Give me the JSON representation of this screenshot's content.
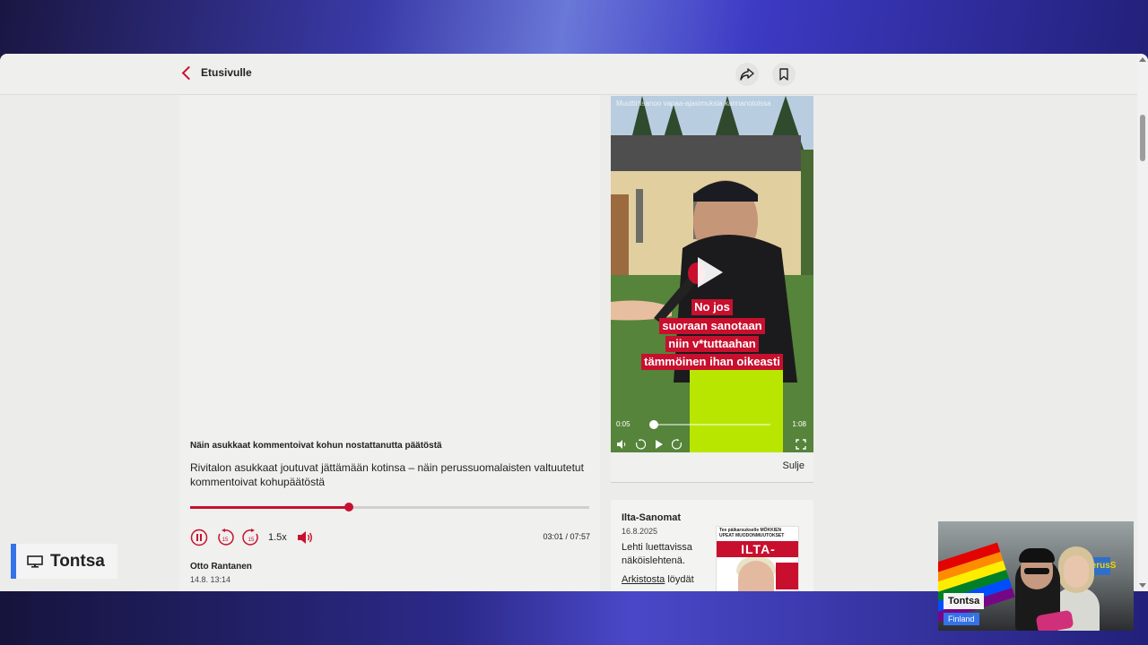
{
  "topbar": {
    "back_label": "Etusivulle"
  },
  "audio": {
    "kicker": "Näin asukkaat kommentoivat kohun nostattanutta päätöstä",
    "title": "Rivitalon asukkaat joutuvat jättämään kotinsa – näin perussuomalaisten valtuutetut kommentoivat kohupäätöstä",
    "progress_fraction": 0.397,
    "rewind_label": "15",
    "forward_label": "15",
    "speed": "1.5x",
    "time": "03:01 / 07:57",
    "author": "Otto Rantanen",
    "date": "14.8. 13:14"
  },
  "video": {
    "top_caption": "Muuttirtisanoo vapaa-ajasimuksia kannanotoissa",
    "subtitles": [
      "No jos",
      "suoraan sanotaan",
      "niin v*tuttaahan",
      "tämmöinen ihan oikeasti"
    ],
    "time_current": "0:05",
    "time_total": "1:08",
    "progress_fraction": 0.074,
    "close_label": "Sulje"
  },
  "promo": {
    "name": "Ilta-Sanomat",
    "date": "16.8.2025",
    "text": "Lehti luettavissa näköislehtenä.",
    "link_label": "Arkistosta",
    "link_suffix": " löydät",
    "cover_strip": "Tee päikarsukselle MÖKKIEN UPEAT MUODONMUUTOKSET",
    "cover_masthead": "ILTA-SANOMAT"
  },
  "overlay": {
    "channel_label": "Tontsa",
    "cam_name": "Tontsa",
    "cam_country": "Finland",
    "cam_sign": "PerusS"
  },
  "colors": {
    "accent_red": "#c8102e",
    "stream_blue": "#3572e8"
  }
}
